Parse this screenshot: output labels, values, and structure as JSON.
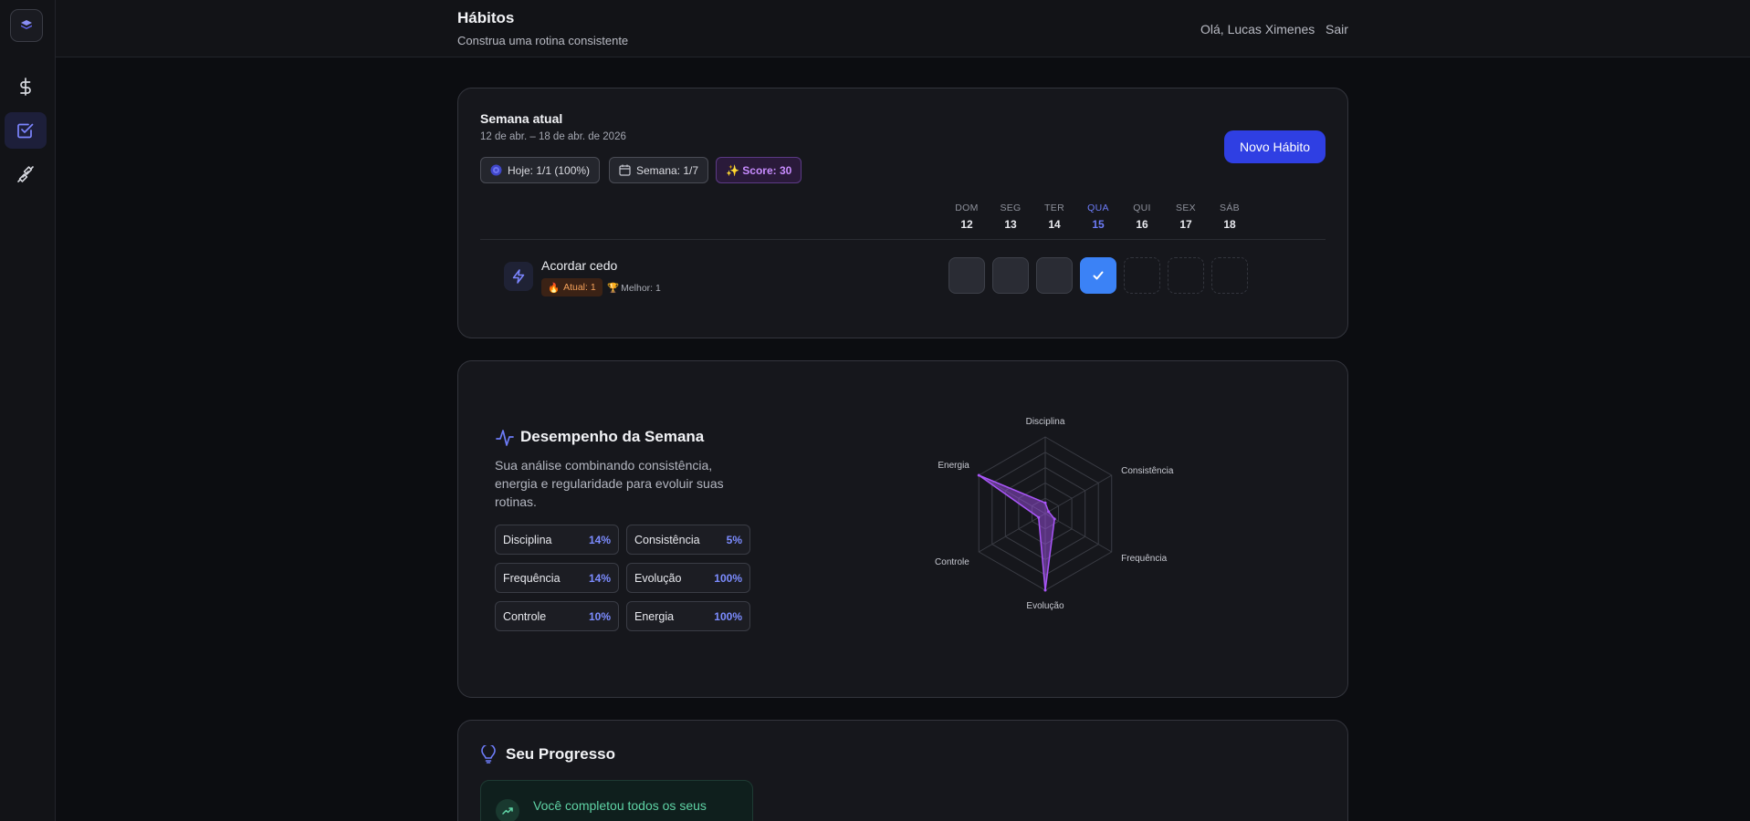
{
  "header": {
    "title": "Hábitos",
    "subtitle": "Construa uma rotina consistente",
    "greeting": "Olá, Lucas Ximenes",
    "logout": "Sair"
  },
  "sidebar": {
    "items": [
      {
        "name": "finance",
        "icon": "dollar-icon"
      },
      {
        "name": "habits",
        "icon": "checkbox-icon",
        "active": true
      },
      {
        "name": "workout",
        "icon": "dumbbell-icon"
      }
    ]
  },
  "week": {
    "title": "Semana atual",
    "range": "12 de abr. – 18 de abr. de 2026",
    "today_pill": "Hoje: 1/1 (100%)",
    "week_pill": "Semana: 1/7",
    "score_pill": "✨ Score: 30",
    "new_habit": "Novo Hábito",
    "days": [
      {
        "name": "DOM",
        "date": "12"
      },
      {
        "name": "SEG",
        "date": "13"
      },
      {
        "name": "TER",
        "date": "14"
      },
      {
        "name": "QUA",
        "date": "15"
      },
      {
        "name": "QUI",
        "date": "16"
      },
      {
        "name": "SEX",
        "date": "17"
      },
      {
        "name": "SÁB",
        "date": "18"
      }
    ],
    "habit": {
      "name": "Acordar cedo",
      "streak": "Atual: 1",
      "best": "Melhor: 1"
    }
  },
  "performance": {
    "title": "Desempenho da Semana",
    "description": "Sua análise combinando consistência, energia e regularidade para evoluir suas rotinas.",
    "metrics": [
      {
        "label": "Disciplina",
        "value": "14%"
      },
      {
        "label": "Consistência",
        "value": "5%"
      },
      {
        "label": "Frequência",
        "value": "14%"
      },
      {
        "label": "Evolução",
        "value": "100%"
      },
      {
        "label": "Controle",
        "value": "10%"
      },
      {
        "label": "Energia",
        "value": "100%"
      }
    ]
  },
  "chart_data": {
    "type": "radar",
    "categories": [
      "Disciplina",
      "Consistência",
      "Frequência",
      "Evolução",
      "Controle",
      "Energia"
    ],
    "values": [
      14,
      5,
      14,
      100,
      10,
      100
    ],
    "range": [
      0,
      100
    ],
    "color": "#a855f7"
  },
  "progress": {
    "title": "Seu Progresso",
    "message": "Você completou todos os seus"
  },
  "colors": {
    "accent": "#2f3fe3",
    "today": "#6d7cf8",
    "done": "#3b82f6",
    "score": "#c88cff"
  }
}
